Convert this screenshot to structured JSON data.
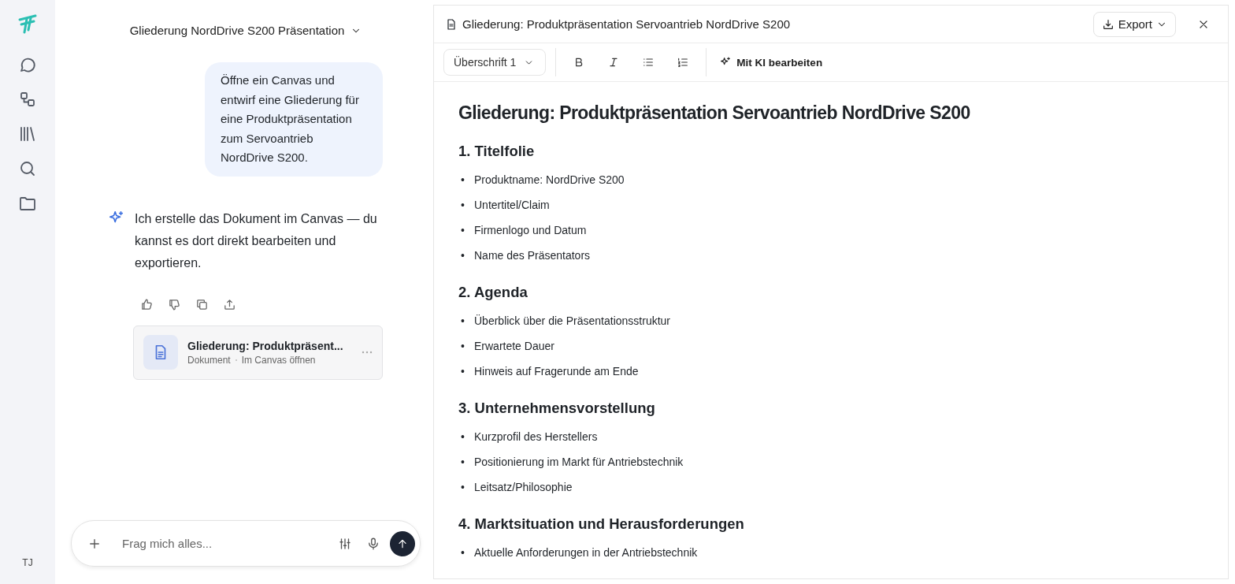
{
  "sidebar": {
    "user_initials": "TJ"
  },
  "chat": {
    "title": "Gliederung NordDrive S200 Präsentation",
    "user_message": "Öffne ein Canvas und entwirf eine Gliederung für eine Produktpräsentation zum Servoantrieb NordDrive S200.",
    "assistant_message": "Ich erstelle das Dokument im Canvas — du kannst es dort direkt bearbeiten und exportieren.",
    "document_card": {
      "title": "Gliederung: Produktpräsent...",
      "type": "Dokument",
      "action": "Im Canvas öffnen"
    },
    "input": {
      "placeholder": "Frag mich alles..."
    }
  },
  "document": {
    "title": "Gliederung: Produktpräsentation Servoantrieb NordDrive S200",
    "export": "Export",
    "toolbar": {
      "style": "Überschrift 1",
      "ai_button": "Mit KI bearbeiten"
    },
    "heading": "Gliederung: Produktpräsentation Servoantrieb NordDrive S200",
    "sections": [
      {
        "heading": "1. Titelfolie",
        "items": [
          {
            "marker": "•",
            "text": "Produktname: NordDrive S200"
          },
          {
            "marker": "•",
            "text": "Untertitel/Claim"
          },
          {
            "marker": "•",
            "text": "Firmenlogo und Datum"
          },
          {
            "marker": "•",
            "text": "Name des Präsentators"
          }
        ]
      },
      {
        "heading": "2. Agenda",
        "items": [
          {
            "marker": "•",
            "text": "Überblick über die Präsentationsstruktur"
          },
          {
            "marker": "•",
            "text": "Erwartete Dauer"
          },
          {
            "marker": "•",
            "text": "Hinweis auf Fragerunde am Ende"
          }
        ]
      },
      {
        "heading": "3. Unternehmensvorstellung",
        "items": [
          {
            "marker": "•",
            "text": "Kurzprofil des Herstellers"
          },
          {
            "marker": "•",
            "text": "Positionierung im Markt für Antriebstechnik"
          },
          {
            "marker": "•",
            "text": "Leitsatz/Philosophie"
          }
        ]
      },
      {
        "heading": "4. Marktsituation und Herausforderungen",
        "items": [
          {
            "marker": "•",
            "text": "Aktuelle Anforderungen in der Antriebstechnik"
          }
        ]
      }
    ]
  }
}
